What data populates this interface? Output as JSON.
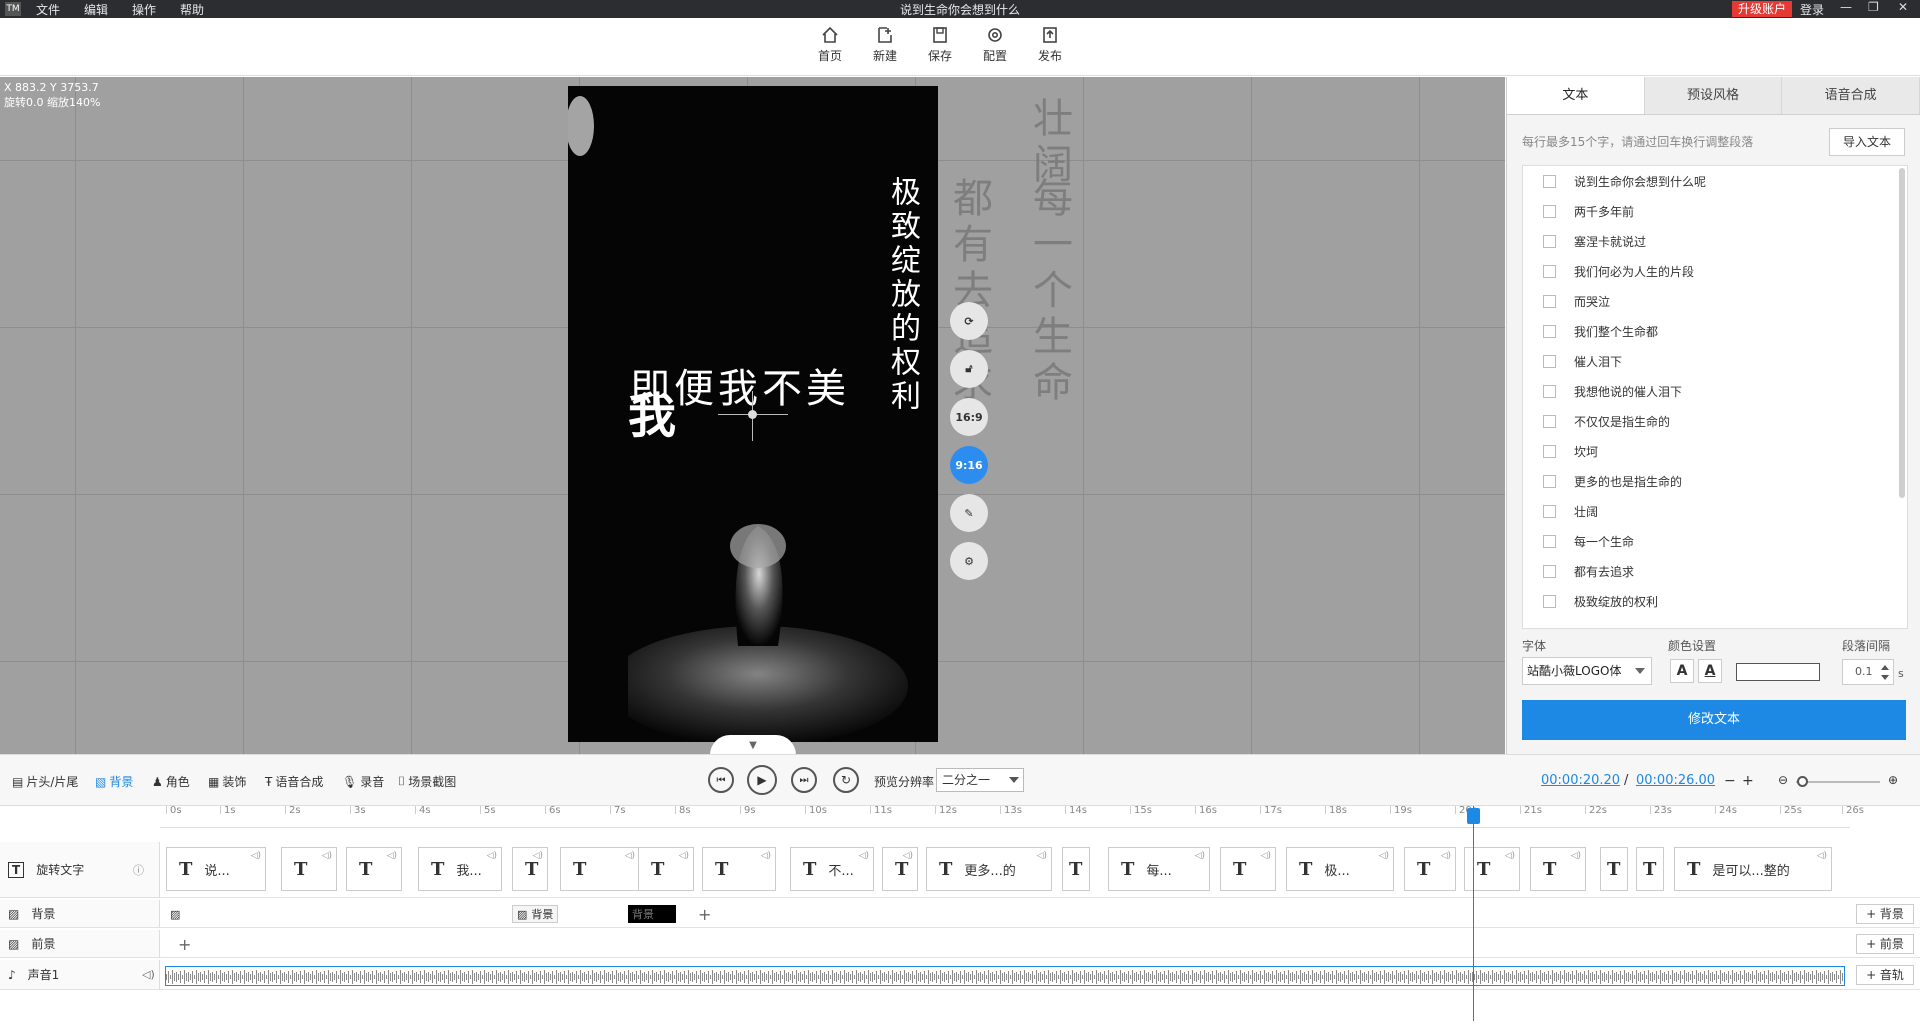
{
  "titlebar": {
    "logo": "TM",
    "menu": [
      "文件",
      "编辑",
      "操作",
      "帮助"
    ],
    "title": "说到生命你会想到什么",
    "upgrade": "升级账户",
    "login": "登录"
  },
  "toolbar": {
    "home": "首页",
    "new": "新建",
    "save": "保存",
    "config": "配置",
    "publish": "发布"
  },
  "canvas": {
    "coords": "X 883.2 Y 3753.7",
    "rotation": "旋转0.0 缩放140%",
    "ghost_texts": [
      "壮阔",
      "每一个生命",
      "都有去追求"
    ],
    "preview_vertical_text": "极致绽放的权利",
    "preview_horizontal_text": "即便我不美",
    "preview_big_char": "我",
    "side_tools": {
      "ratio_169": "16:9",
      "ratio_916": "9:16"
    }
  },
  "right_panel": {
    "tabs": [
      "文本",
      "预设风格",
      "语音合成"
    ],
    "hint": "每行最多15个字，请通过回车换行调整段落",
    "import_button": "导入文本",
    "text_lines": [
      "说到生命你会想到什么呢",
      "两千多年前",
      "塞涅卡就说过",
      "我们何必为人生的片段",
      "而哭泣",
      "我们整个生命都",
      "催人泪下",
      "我想他说的催人泪下",
      "不仅仅是指生命的",
      "坎坷",
      "更多的也是指生命的",
      "壮阔",
      "每一个生命",
      "都有去追求",
      "极致绽放的权利"
    ],
    "font_label": "字体",
    "font_value": "站酷小薇LOGO体",
    "color_label": "颜色设置",
    "spacing_label": "段落间隔",
    "spacing_value": "0.1",
    "spacing_unit": "s",
    "modify_button": "修改文本"
  },
  "timeline_bar": {
    "buttons": [
      "片头/片尾",
      "背景",
      "角色",
      "装饰",
      "语音合成",
      "录音",
      "场景截图"
    ],
    "rate_label": "预览分辨率",
    "rate_value": "二分之一",
    "current_time": "00:00:20.20",
    "separator": "/",
    "total_time": "00:00:26.00",
    "zoom_out": "−",
    "zoom_in": "+"
  },
  "timeline": {
    "ticks": [
      "0s",
      "1s",
      "2s",
      "3s",
      "4s",
      "5s",
      "6s",
      "7s",
      "8s",
      "9s",
      "10s",
      "11s",
      "12s",
      "13s",
      "14s",
      "15s",
      "16s",
      "17s",
      "18s",
      "19s",
      "20s",
      "21s",
      "22s",
      "23s",
      "24s",
      "25s",
      "26s"
    ],
    "tracks": {
      "text": "旋转文字",
      "background": "背景",
      "foreground": "前景",
      "audio": "声音1"
    },
    "text_clips": [
      "说...",
      "",
      "",
      "我...",
      "",
      "",
      "",
      "",
      "不...",
      "",
      "更多...的",
      "",
      "每...",
      "",
      "极...",
      "",
      "",
      "",
      "",
      "",
      "是可以...整的"
    ],
    "bg_clip_1": "背景",
    "bg_clip_2": "背景",
    "add_background": "+ 背景",
    "add_foreground": "+ 前景",
    "add_audio": "+ 音轨"
  }
}
